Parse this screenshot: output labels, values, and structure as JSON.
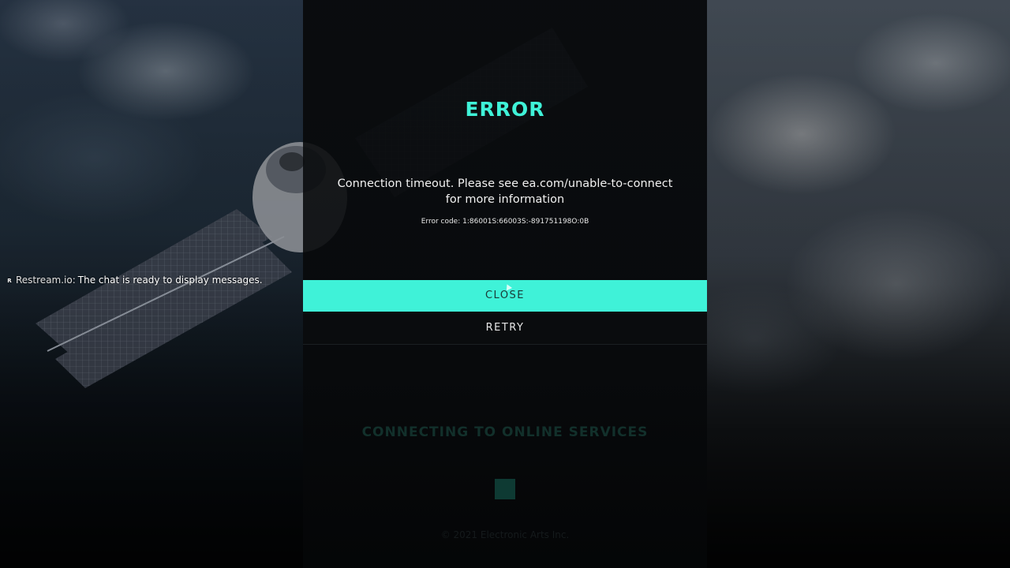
{
  "dialog": {
    "title": "ERROR",
    "message_line1": "Connection timeout. Please see ea.com/unable-to-connect",
    "message_line2": "for more information",
    "error_code": "Error code: 1:86001S:66003S:-891751198O:0B",
    "close_label": "CLOSE",
    "retry_label": "RETRY"
  },
  "loading": {
    "status": "CONNECTING TO ONLINE SERVICES",
    "copyright": "© 2021 Electronic Arts Inc."
  },
  "chat": {
    "icon": "restream-icon",
    "icon_letter": "R",
    "sender": "Restream.io:",
    "message": "The chat is ready to display messages."
  },
  "colors": {
    "accent": "#3ff2d8",
    "dialog_bg": "#0a0c0e"
  }
}
